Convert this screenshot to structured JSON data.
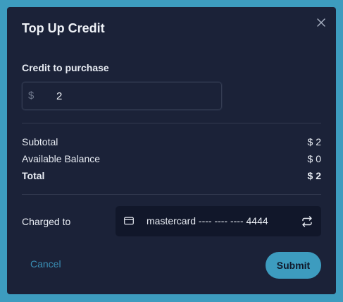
{
  "dialog": {
    "title": "Top Up Credit",
    "close_icon": "close-icon"
  },
  "credit": {
    "label": "Credit to purchase",
    "currency_symbol": "$",
    "amount_value": "2"
  },
  "summary": {
    "subtotal_label": "Subtotal",
    "subtotal_value": "$ 2",
    "balance_label": "Available Balance",
    "balance_value": "$ 0",
    "total_label": "Total",
    "total_value": "$ 2"
  },
  "payment": {
    "charged_label": "Charged to",
    "card_icon": "credit-card-icon",
    "card_text": "mastercard ---- ---- ---- 4444",
    "swap_icon": "swap-arrows-icon"
  },
  "actions": {
    "cancel_label": "Cancel",
    "submit_label": "Submit"
  },
  "colors": {
    "backdrop": "#3d9cbf",
    "modal_bg": "#1b2238",
    "card_bg": "#11172a",
    "accent": "#3d9cbf",
    "cancel_text": "#3a8fb5"
  }
}
